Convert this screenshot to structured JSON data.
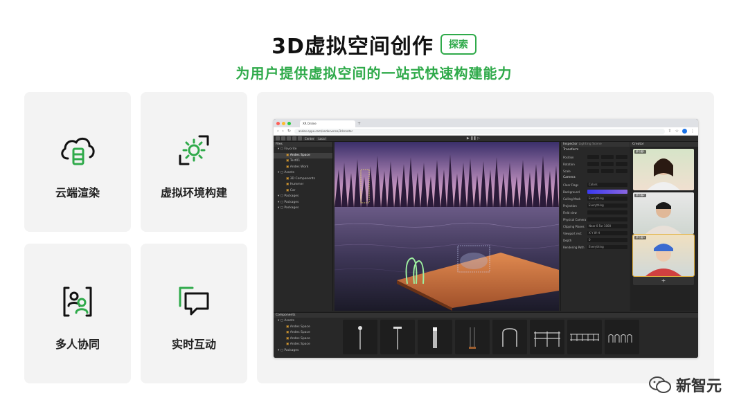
{
  "header": {
    "title": "3D虚拟空间创作",
    "explore_label": "探索",
    "subtitle": "为用户提供虚拟空间的一站式快速构建能力"
  },
  "features": [
    {
      "label": "云端渲染",
      "icon": "cloud-render-icon"
    },
    {
      "label": "虚拟环境构建",
      "icon": "virtual-env-icon"
    },
    {
      "label": "多人协同",
      "icon": "multi-user-icon"
    },
    {
      "label": "实时互动",
      "icon": "chat-bubbles-icon"
    }
  ],
  "colors": {
    "accent": "#2faa4a",
    "card_bg": "#f3f3f3",
    "editor_bg": "#262626"
  },
  "browser": {
    "tab_title": "XR Online",
    "url": "andes.oppo.com/andesverse/3dcreator"
  },
  "editor": {
    "toolbar": {
      "center_label": "Center",
      "local_label": "Local"
    },
    "files_panel": {
      "title": "Files",
      "items": [
        {
          "label": "Favorite",
          "level": 1
        },
        {
          "label": "Andes Space",
          "level": 2,
          "selected": true
        },
        {
          "label": "Test01",
          "level": 2
        },
        {
          "label": "Andes Work",
          "level": 2
        },
        {
          "label": "Assets",
          "level": 1
        },
        {
          "label": "3D Components",
          "level": 2
        },
        {
          "label": "Hummer",
          "level": 2
        },
        {
          "label": "Car",
          "level": 2
        },
        {
          "label": "Packages",
          "level": 1
        },
        {
          "label": "Packages",
          "level": 1
        },
        {
          "label": "Packages",
          "level": 1
        }
      ]
    },
    "inspector": {
      "tabs": [
        "Inspector",
        "Lighting",
        "Scene"
      ],
      "transform_title": "Transform",
      "transform_rows": [
        "Position",
        "Rotation",
        "Scale"
      ],
      "camera_title": "Camera",
      "camera_rows": [
        {
          "label": "Clear Flags",
          "value": "Colors"
        },
        {
          "label": "Background",
          "value": ""
        },
        {
          "label": "Culling Mask",
          "value": "Everything"
        },
        {
          "label": "Projection",
          "value": "Everything"
        },
        {
          "label": "Field view",
          "value": ""
        },
        {
          "label": "Physical Camera",
          "value": ""
        },
        {
          "label": "Clipping Planes",
          "value": "Near  0   Far  1000"
        },
        {
          "label": "Viewport rect",
          "value": "X   Y   W   H"
        },
        {
          "label": "Depth",
          "value": "0"
        },
        {
          "label": "Rendering Path",
          "value": "Everything"
        }
      ]
    },
    "creator_panel": {
      "title": "Creator",
      "participants": [
        "参与者1",
        "参与者2",
        "参与者3"
      ],
      "add_label": "+"
    },
    "components_panel": {
      "title": "Components",
      "items": [
        {
          "label": "Assets",
          "level": 1
        },
        {
          "label": "Andes Space",
          "level": 2
        },
        {
          "label": "Andes Space",
          "level": 2
        },
        {
          "label": "Andes Space",
          "level": 2
        },
        {
          "label": "Andes Space",
          "level": 2
        },
        {
          "label": "Packages",
          "level": 1
        }
      ]
    }
  },
  "watermark": "新智元"
}
